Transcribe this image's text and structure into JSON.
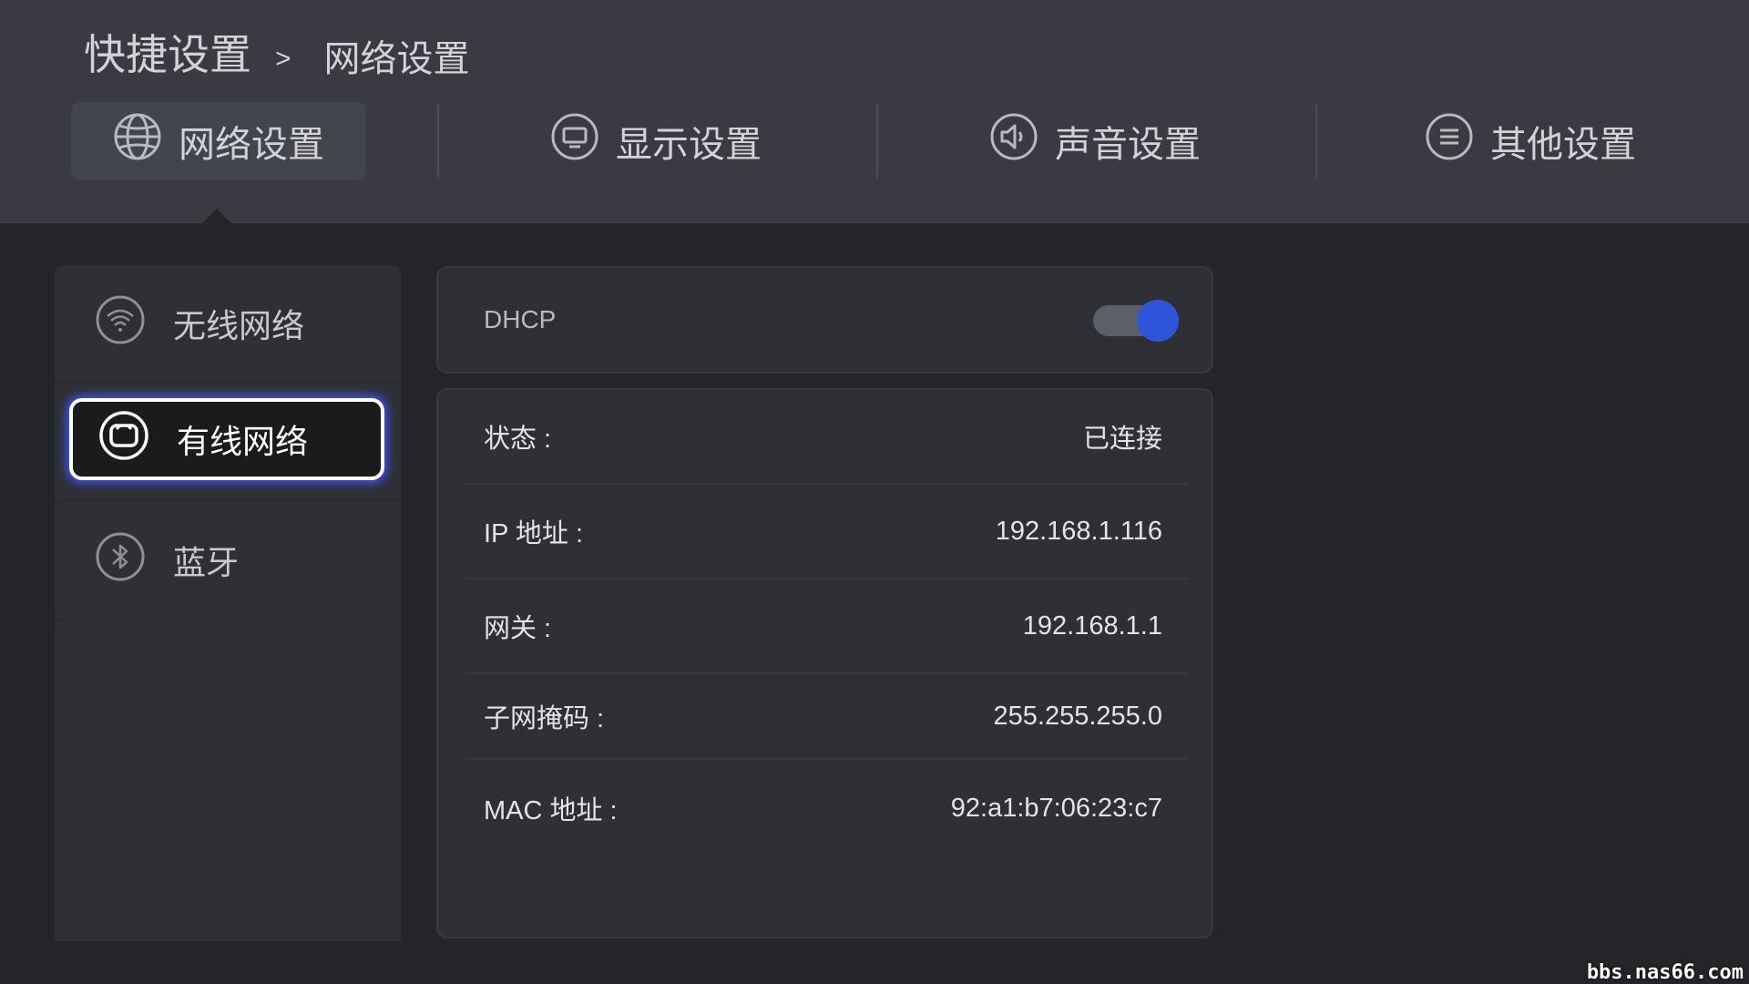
{
  "breadcrumb": {
    "root": "快捷设置",
    "separator": ">",
    "current": "网络设置"
  },
  "tabs": [
    {
      "label": "网络设置",
      "icon": "globe-icon",
      "active": true
    },
    {
      "label": "显示设置",
      "icon": "monitor-icon",
      "active": false
    },
    {
      "label": "声音设置",
      "icon": "speaker-icon",
      "active": false
    },
    {
      "label": "其他设置",
      "icon": "menu-icon",
      "active": false
    }
  ],
  "sidebar": {
    "items": [
      {
        "label": "无线网络",
        "icon": "wifi-icon",
        "selected": false
      },
      {
        "label": "有线网络",
        "icon": "ethernet-icon",
        "selected": true
      },
      {
        "label": "蓝牙",
        "icon": "bluetooth-icon",
        "selected": false
      }
    ]
  },
  "dhcp": {
    "label": "DHCP",
    "enabled": true
  },
  "network_info": [
    {
      "label": "状态 :",
      "value": "已连接"
    },
    {
      "label": "IP 地址 :",
      "value": "192.168.1.116"
    },
    {
      "label": "网关 :",
      "value": "192.168.1.1"
    },
    {
      "label": "子网掩码 :",
      "value": "255.255.255.0"
    },
    {
      "label": "MAC 地址 :",
      "value": "92:a1:b7:06:23:c7"
    }
  ],
  "watermark": "bbs.nas66.com",
  "colors": {
    "accent": "#2e55d8",
    "focus_glow": "#3e55ff",
    "topbar_bg": "#3a3b42",
    "page_bg": "#242529"
  }
}
